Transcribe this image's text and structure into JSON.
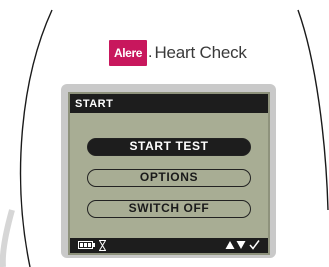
{
  "brand": {
    "logo": "Alere",
    "product": "Heart Check"
  },
  "screen": {
    "title": "START",
    "menu": [
      {
        "label": "START TEST",
        "selected": true
      },
      {
        "label": "OPTIONS",
        "selected": false
      },
      {
        "label": "SWITCH OFF",
        "selected": false
      }
    ],
    "status_icons": [
      "battery-icon",
      "hourglass-icon",
      "up-arrow-icon",
      "down-arrow-icon",
      "check-icon"
    ]
  },
  "colors": {
    "brand_accent": "#c8175d",
    "lcd_background": "#a8ad94",
    "lcd_dark": "#1d1d1d"
  }
}
